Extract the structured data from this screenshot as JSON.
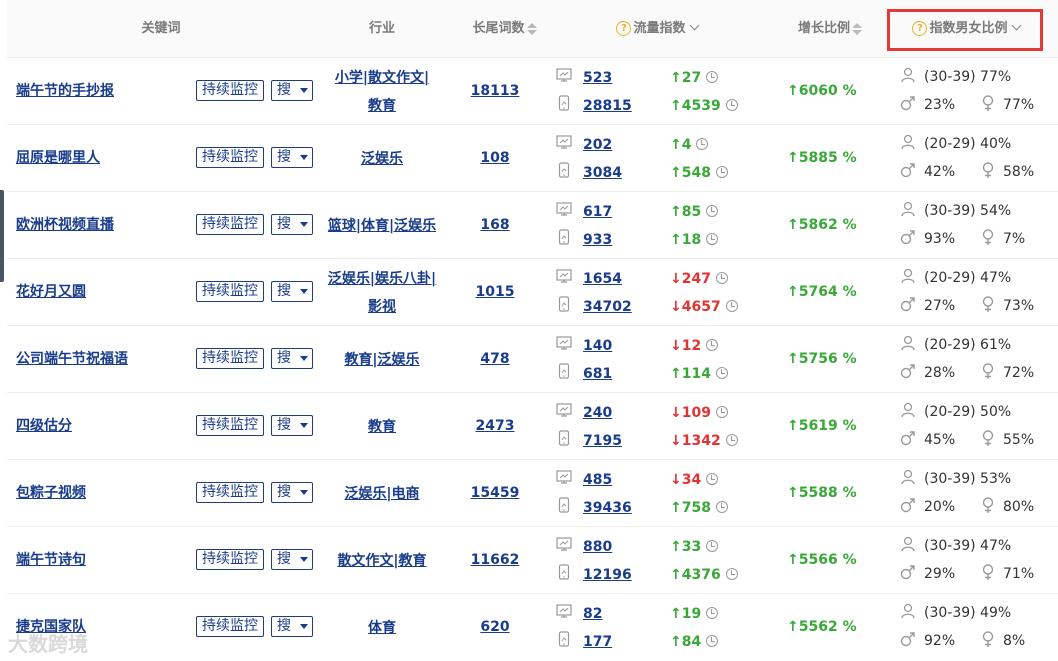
{
  "header": {
    "keyword": "关键词",
    "industry": "行业",
    "longtail": "长尾词数",
    "traffic": "流量指数",
    "growth": "增长比例",
    "gender": "指数男女比例"
  },
  "monitor_label": "持续监控",
  "search_label": "搜",
  "rows": [
    {
      "kw": "端午节的手抄报",
      "ind": [
        "小学|散文作文|",
        "教育"
      ],
      "lt": "18113",
      "pc": "523",
      "pc_ch": "27",
      "pc_dir": "up",
      "mb": "28815",
      "mb_ch": "4539",
      "mb_dir": "up",
      "growth": "6060 %",
      "age": "(30-39) 77%",
      "male": "23%",
      "female": "77%"
    },
    {
      "kw": "屈原是哪里人",
      "ind": [
        "泛娱乐"
      ],
      "lt": "108",
      "pc": "202",
      "pc_ch": "4",
      "pc_dir": "up",
      "mb": "3084",
      "mb_ch": "548",
      "mb_dir": "up",
      "growth": "5885 %",
      "age": "(20-29) 40%",
      "male": "42%",
      "female": "58%"
    },
    {
      "kw": "欧洲杯视频直播",
      "ind": [
        "篮球|体育|泛娱乐"
      ],
      "lt": "168",
      "pc": "617",
      "pc_ch": "85",
      "pc_dir": "up",
      "mb": "933",
      "mb_ch": "18",
      "mb_dir": "up",
      "growth": "5862 %",
      "age": "(30-39) 54%",
      "male": "93%",
      "female": "7%"
    },
    {
      "kw": "花好月又圆",
      "ind": [
        "泛娱乐|娱乐八卦|",
        "影视"
      ],
      "lt": "1015",
      "pc": "1654",
      "pc_ch": "247",
      "pc_dir": "down",
      "mb": "34702",
      "mb_ch": "4657",
      "mb_dir": "down",
      "growth": "5764 %",
      "age": "(20-29) 47%",
      "male": "27%",
      "female": "73%"
    },
    {
      "kw": "公司端午节祝福语",
      "ind": [
        "教育|泛娱乐"
      ],
      "lt": "478",
      "pc": "140",
      "pc_ch": "12",
      "pc_dir": "down",
      "mb": "681",
      "mb_ch": "114",
      "mb_dir": "up",
      "growth": "5756 %",
      "age": "(20-29) 61%",
      "male": "28%",
      "female": "72%"
    },
    {
      "kw": "四级估分",
      "ind": [
        "教育"
      ],
      "lt": "2473",
      "pc": "240",
      "pc_ch": "109",
      "pc_dir": "down",
      "mb": "7195",
      "mb_ch": "1342",
      "mb_dir": "down",
      "growth": "5619 %",
      "age": "(20-29) 50%",
      "male": "45%",
      "female": "55%"
    },
    {
      "kw": "包粽子视频",
      "ind": [
        "泛娱乐|电商"
      ],
      "lt": "15459",
      "pc": "485",
      "pc_ch": "34",
      "pc_dir": "down",
      "mb": "39436",
      "mb_ch": "758",
      "mb_dir": "up",
      "growth": "5588 %",
      "age": "(30-39) 53%",
      "male": "20%",
      "female": "80%"
    },
    {
      "kw": "端午节诗句",
      "ind": [
        "散文作文|教育"
      ],
      "lt": "11662",
      "pc": "880",
      "pc_ch": "33",
      "pc_dir": "up",
      "mb": "12196",
      "mb_ch": "4376",
      "mb_dir": "up",
      "growth": "5566 %",
      "age": "(30-39) 47%",
      "male": "29%",
      "female": "71%"
    },
    {
      "kw": "捷克国家队",
      "ind": [
        "体育"
      ],
      "lt": "620",
      "pc": "82",
      "pc_ch": "19",
      "pc_dir": "up",
      "mb": "177",
      "mb_ch": "84",
      "mb_dir": "up",
      "growth": "5562 %",
      "age": "(30-39) 49%",
      "male": "92%",
      "female": "8%"
    }
  ],
  "watermark": "大数跨境",
  "colors": {
    "accent": "#1a3c8c",
    "up": "#39a839",
    "down": "#e03333",
    "highlight": "#e53935"
  },
  "icons": [
    "question-icon",
    "sort-icon",
    "chevron-down-icon",
    "desktop-icon",
    "mobile-icon",
    "arrow-up-icon",
    "arrow-down-icon",
    "clock-icon",
    "person-icon",
    "male-icon",
    "female-icon"
  ]
}
